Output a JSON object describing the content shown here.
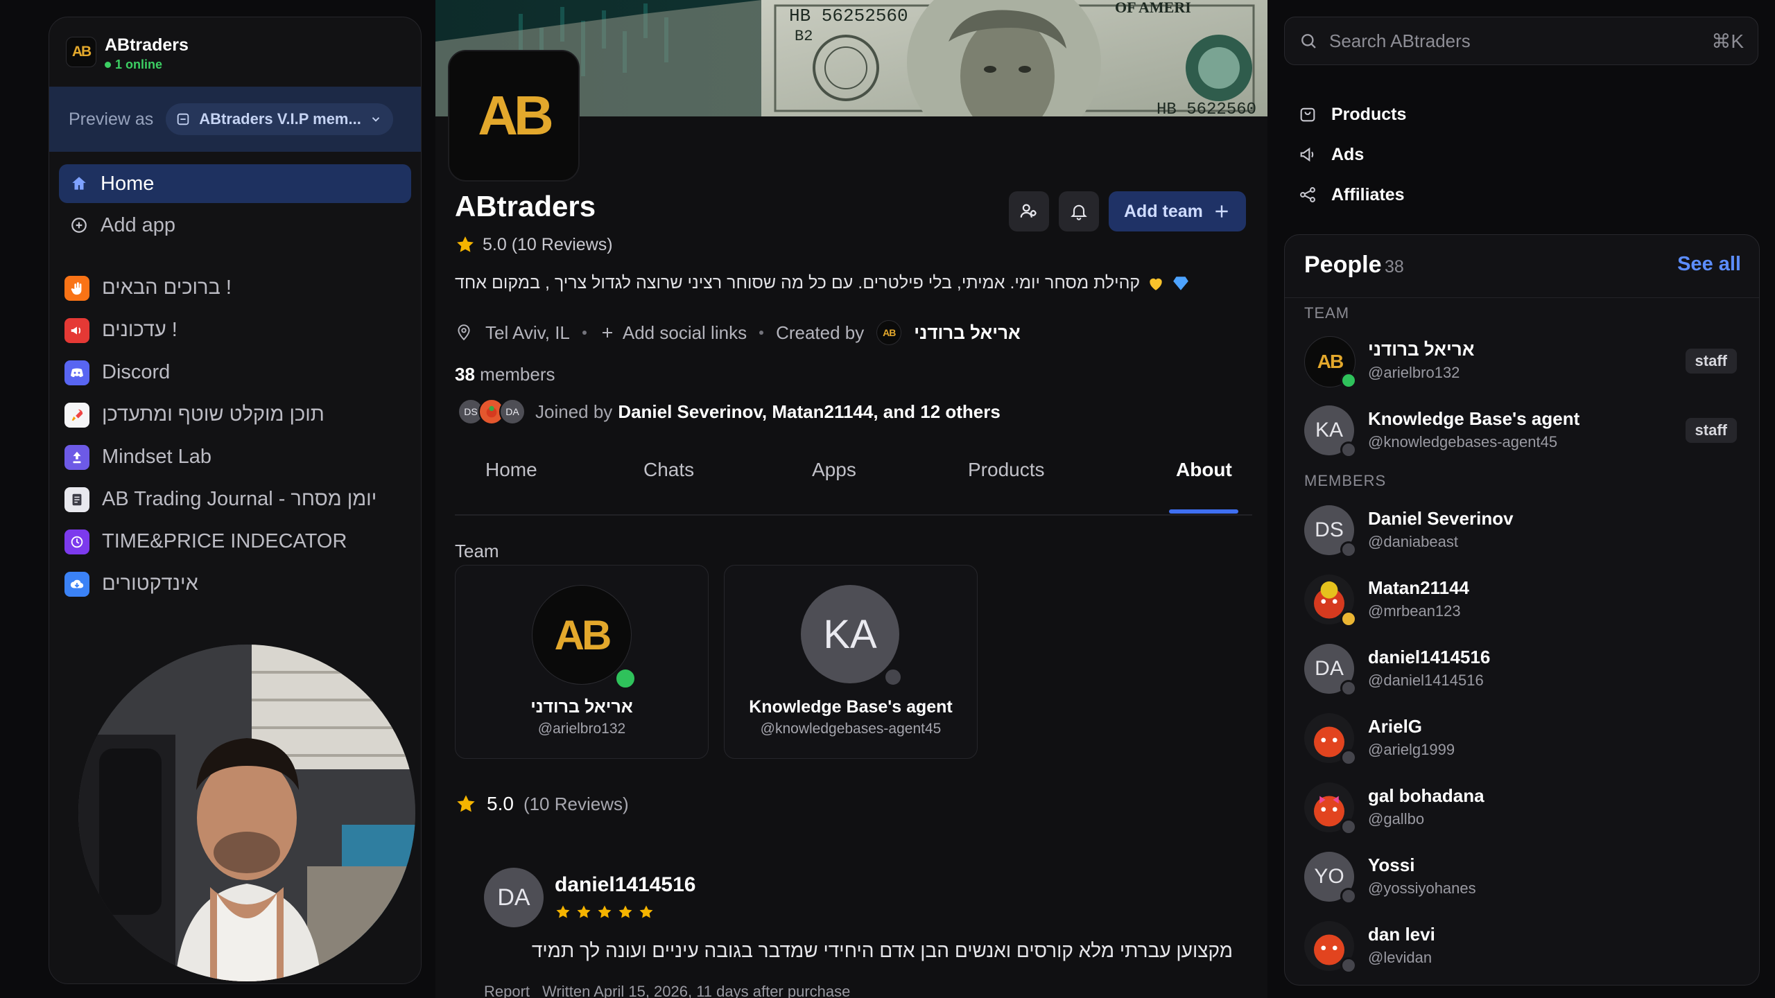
{
  "workspace": {
    "logo_text": "AB",
    "name": "ABtraders",
    "online": "1 online",
    "preview_label": "Preview as",
    "preview_value": "ABtraders V.I.P mem..."
  },
  "nav": [
    {
      "label": "Home"
    },
    {
      "label": "Add app"
    }
  ],
  "apps": [
    {
      "label": "ברוכים הבאים !"
    },
    {
      "label": "עדכונים !"
    },
    {
      "label": "Discord"
    },
    {
      "label": "תוכן מוקלט שוטף ומתעדכן"
    },
    {
      "label": "Mindset Lab"
    },
    {
      "label": "AB Trading Journal - יומן מסחר"
    },
    {
      "label": "TIME&PRICE INDECATOR"
    },
    {
      "label": "אינדקטורים"
    }
  ],
  "banner": {
    "serial_1": "HB 56252560",
    "serial_2": "B2",
    "serial_3": "HB 5622560",
    "banner_text": "OF AMERI"
  },
  "hub": {
    "logo_text": "AB",
    "title": "ABtraders",
    "rating": "5.0 (10 Reviews)",
    "description": "קהילת מסחר יומי. אמיתי, בלי פילטרים. עם כל מה שסוחר רציני שרוצה לגדול צריך , במקום אחד",
    "location": "Tel Aviv, IL",
    "add_social": "Add social links",
    "created_by_label": "Created by",
    "creator_name": "אריאל ברודני",
    "members_count": "38",
    "members_label": "members",
    "joined_prefix": "Joined by",
    "joined_names": "Daniel Severinov, Matan21144, and 12 others",
    "joined_avatars": [
      "DS",
      "",
      "DA"
    ],
    "add_team_label": "Add team"
  },
  "tabs": [
    {
      "label": "Home"
    },
    {
      "label": "Chats"
    },
    {
      "label": "Apps"
    },
    {
      "label": "Products"
    },
    {
      "label": "About"
    }
  ],
  "active_tab": "About",
  "team_section": {
    "label": "Team",
    "cards": [
      {
        "name": "אריאל ברודני",
        "handle": "@arielbro132",
        "avatar": "AB"
      },
      {
        "name": "Knowledge Base's agent",
        "handle": "@knowledgebases-agent45",
        "avatar": "KA"
      }
    ]
  },
  "reviews": {
    "score": "5.0",
    "count": "(10 Reviews)",
    "items": [
      {
        "avatar": "DA",
        "name": "daniel1414516",
        "stars": 5,
        "text": "מקצוען עברתי מלא קורסים ואנשים הבן אדם היחידי שמדבר בגובה עיניים ועונה לך תמיד",
        "report": "Report",
        "written": "Written April 15, 2026, 11 days after purchase"
      }
    ]
  },
  "search": {
    "placeholder": "Search ABtraders",
    "shortcut": "⌘K"
  },
  "quick_links": [
    {
      "label": "Products"
    },
    {
      "label": "Ads"
    },
    {
      "label": "Affiliates"
    }
  ],
  "people": {
    "title": "People",
    "count": "38",
    "see_all": "See all",
    "team_label": "TEAM",
    "members_label": "MEMBERS",
    "team": [
      {
        "name": "אריאל ברודני",
        "handle": "@arielbro132",
        "avatar": "AB",
        "badge": "staff",
        "status": "online"
      },
      {
        "name": "Knowledge Base's agent",
        "handle": "@knowledgebases-agent45",
        "avatar": "KA",
        "badge": "staff",
        "status": "offline"
      }
    ],
    "members": [
      {
        "name": "Daniel Severinov",
        "handle": "@daniabeast",
        "avatar": "DS",
        "status": "offline"
      },
      {
        "name": "Matan21144",
        "handle": "@mrbean123",
        "avatar": "",
        "status": "idle"
      },
      {
        "name": "daniel1414516",
        "handle": "@daniel1414516",
        "avatar": "DA",
        "status": "offline"
      },
      {
        "name": "ArielG",
        "handle": "@arielg1999",
        "avatar": "",
        "status": "offline"
      },
      {
        "name": "gal bohadana",
        "handle": "@gallbo",
        "avatar": "",
        "status": "offline"
      },
      {
        "name": "Yossi",
        "handle": "@yossiyohanes",
        "avatar": "YO",
        "status": "offline"
      },
      {
        "name": "dan levi",
        "handle": "@levidan",
        "avatar": "",
        "status": "offline"
      }
    ]
  },
  "colors": {
    "accent": "#3f6ff1",
    "brand_gold": "#e3a82c",
    "online": "#2fc25b",
    "idle": "#eab533",
    "star": "#f5b400"
  }
}
